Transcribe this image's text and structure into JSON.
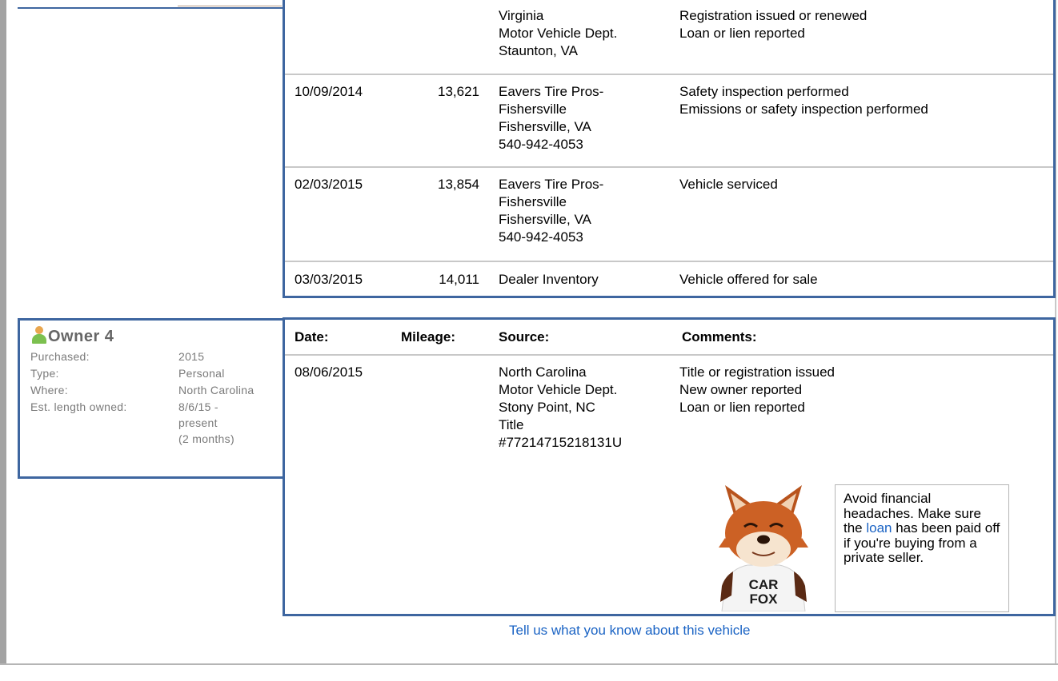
{
  "owner3_history": [
    {
      "date": "",
      "mileage": "",
      "source": [
        "Virginia",
        "Motor Vehicle Dept.",
        "Staunton, VA"
      ],
      "comments": [
        "Registration issued or renewed",
        "Loan or lien reported"
      ]
    },
    {
      "date": "10/09/2014",
      "mileage": "13,621",
      "source": [
        "Eavers Tire Pros-",
        "Fishersville",
        "Fishersville, VA",
        "540-942-4053"
      ],
      "comments": [
        "Safety inspection performed",
        "Emissions or safety inspection performed"
      ]
    },
    {
      "date": "02/03/2015",
      "mileage": "13,854",
      "source": [
        "Eavers Tire Pros-",
        "Fishersville",
        "Fishersville, VA",
        "540-942-4053"
      ],
      "comments": [
        "Vehicle serviced"
      ]
    },
    {
      "date": "03/03/2015",
      "mileage": "14,011",
      "source": [
        "Dealer Inventory"
      ],
      "comments": [
        "Vehicle offered for sale"
      ]
    }
  ],
  "owner4": {
    "title": "Owner 4",
    "icon": "person-icon",
    "fields": {
      "purchased_label": "Purchased:",
      "purchased": "2015",
      "type_label": "Type:",
      "type": "Personal",
      "where_label": "Where:",
      "where": "North Carolina",
      "length_label": "Est. length owned:",
      "length_1": "8/6/15 -",
      "length_2": "present",
      "length_3": "(2 months)"
    }
  },
  "owner4_table": {
    "headers": {
      "date": "Date:",
      "mileage": "Mileage:",
      "source": "Source:",
      "comments": "Comments:"
    },
    "rows": [
      {
        "date": "08/06/2015",
        "mileage": "",
        "source": [
          "North Carolina",
          "Motor Vehicle Dept.",
          "Stony Point, NC",
          "Title",
          "#77214715218131U"
        ],
        "comments": [
          "Title or registration issued",
          "New owner reported",
          "Loan or lien reported"
        ]
      }
    ]
  },
  "tip": {
    "pre": "Avoid financial headaches. Make sure the ",
    "link": "loan",
    "post": " has been paid off if you're buying from a private seller."
  },
  "mascot": {
    "shirt_line1": "CAR",
    "shirt_line2": "FOX"
  },
  "footer_link": "Tell us what you know about this vehicle",
  "colors": {
    "border": "#3e66a0",
    "link": "#1a63c4",
    "label": "#7a7a7a"
  }
}
